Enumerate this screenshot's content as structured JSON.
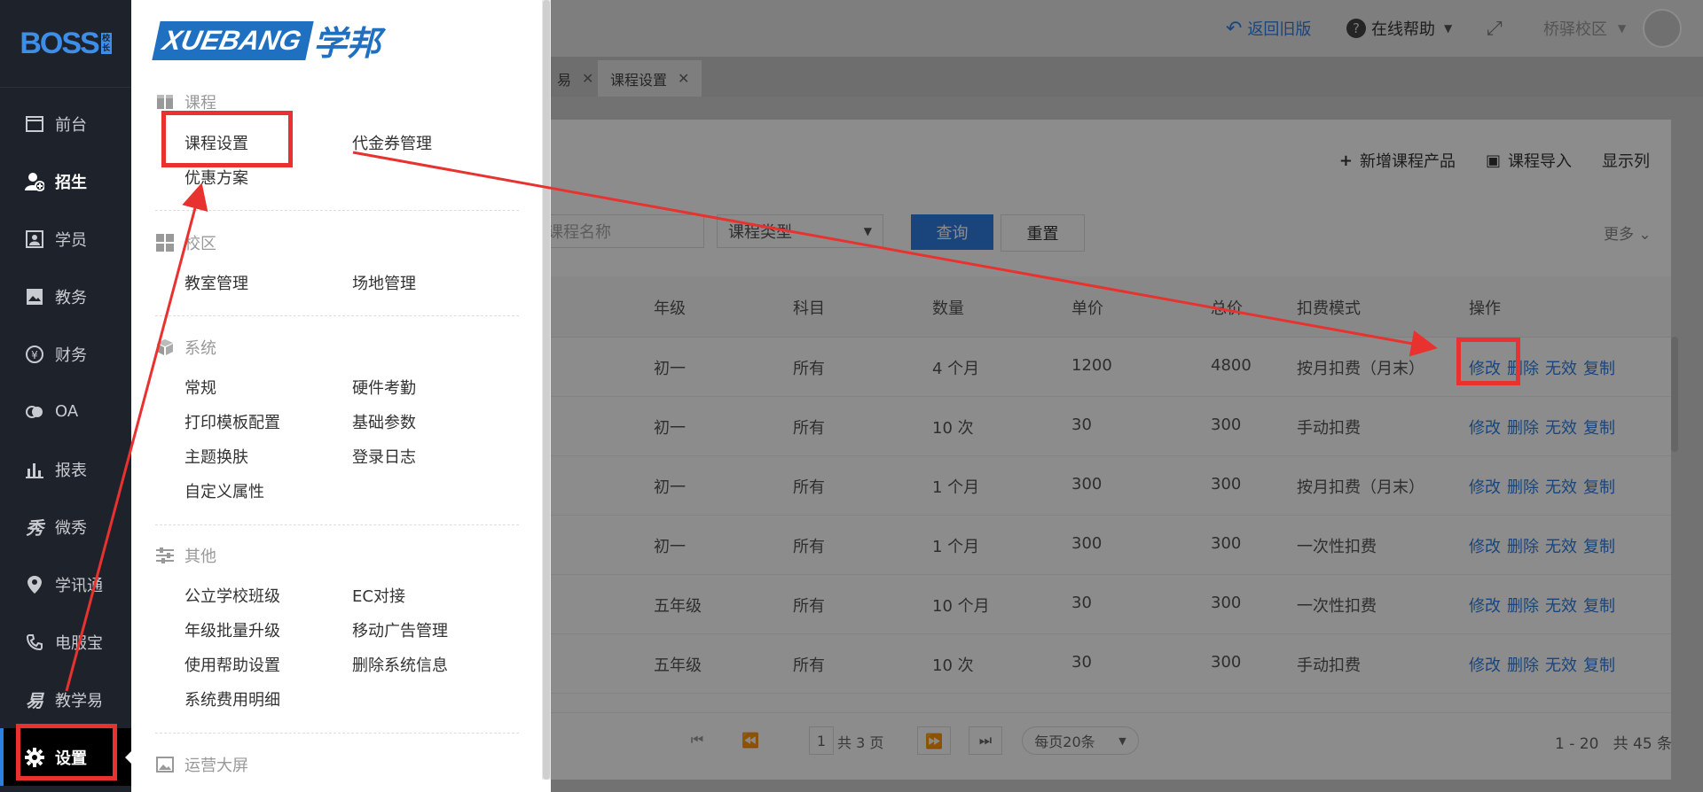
{
  "sidebar": {
    "logo": "BOSS",
    "logo_badge": "校长",
    "items": [
      {
        "label": "前台",
        "icon": "browser-icon"
      },
      {
        "label": "招生",
        "icon": "user-add-icon"
      },
      {
        "label": "学员",
        "icon": "id-card-icon"
      },
      {
        "label": "教务",
        "icon": "picture-book-icon"
      },
      {
        "label": "财务",
        "icon": "yen-icon"
      },
      {
        "label": "OA",
        "icon": "oa-icon"
      },
      {
        "label": "报表",
        "icon": "bar-chart-icon"
      },
      {
        "label": "微秀",
        "icon": "weixiu-icon"
      },
      {
        "label": "学讯通",
        "icon": "location-icon"
      },
      {
        "label": "电服宝",
        "icon": "phone-icon"
      },
      {
        "label": "教学易",
        "icon": "teaching-icon"
      },
      {
        "label": "设置",
        "icon": "gear-icon"
      }
    ]
  },
  "header": {
    "back_old": "返回旧版",
    "help": "在线帮助",
    "campus": "桥驿校区"
  },
  "tabs": [
    {
      "label": "易"
    },
    {
      "label": "课程设置"
    }
  ],
  "panel": {
    "actions": [
      "新增课程产品",
      "课程导入",
      "显示列"
    ],
    "filter_placeholder": "课程名称",
    "course_type": "课程类型",
    "query": "查询",
    "reset": "重置",
    "more": "更多"
  },
  "table": {
    "columns": [
      "年级",
      "科目",
      "数量",
      "单价",
      "总价",
      "扣费模式",
      "操作"
    ],
    "rows": [
      [
        "初一",
        "所有",
        "4 个月",
        "1200",
        "4800",
        "按月扣费（月末）"
      ],
      [
        "初一",
        "所有",
        "10 次",
        "30",
        "300",
        "手动扣费"
      ],
      [
        "初一",
        "所有",
        "1 个月",
        "300",
        "300",
        "按月扣费（月末）"
      ],
      [
        "初一",
        "所有",
        "1 个月",
        "300",
        "300",
        "一次性扣费"
      ],
      [
        "五年级",
        "所有",
        "10 个月",
        "30",
        "300",
        "一次性扣费"
      ],
      [
        "五年级",
        "所有",
        "10 次",
        "30",
        "300",
        "手动扣费"
      ]
    ],
    "ops": [
      "修改",
      "删除",
      "无效",
      "复制"
    ]
  },
  "pager": {
    "page": "1",
    "total_pages": "共 3 页",
    "page_size": "每页20条",
    "range": "1 - 20",
    "total": "共 45 条"
  },
  "flyout": {
    "brand_latin": "XUEBANG",
    "brand_cn": "学邦",
    "sections": [
      {
        "title": "课程",
        "icon": "gift-icon",
        "links": [
          "课程设置",
          "代金券管理",
          "优惠方案"
        ]
      },
      {
        "title": "校区",
        "icon": "grid-icon",
        "links": [
          "教室管理",
          "场地管理"
        ]
      },
      {
        "title": "系统",
        "icon": "cube-icon",
        "links": [
          "常规",
          "硬件考勤",
          "打印模板配置",
          "基础参数",
          "主题换肤",
          "登录日志",
          "自定义属性"
        ]
      },
      {
        "title": "其他",
        "icon": "sliders-icon",
        "links": [
          "公立学校班级",
          "EC对接",
          "年级批量升级",
          "移动广告管理",
          "使用帮助设置",
          "删除系统信息",
          "系统费用明细"
        ]
      },
      {
        "title": "运营大屏",
        "icon": "image-icon",
        "links": []
      }
    ]
  },
  "colors": {
    "sidebar_bg": "#1e222a",
    "accent_blue": "#2f7fe2",
    "annotation_red": "#e8322f",
    "brand_blue": "#1f70c1"
  }
}
